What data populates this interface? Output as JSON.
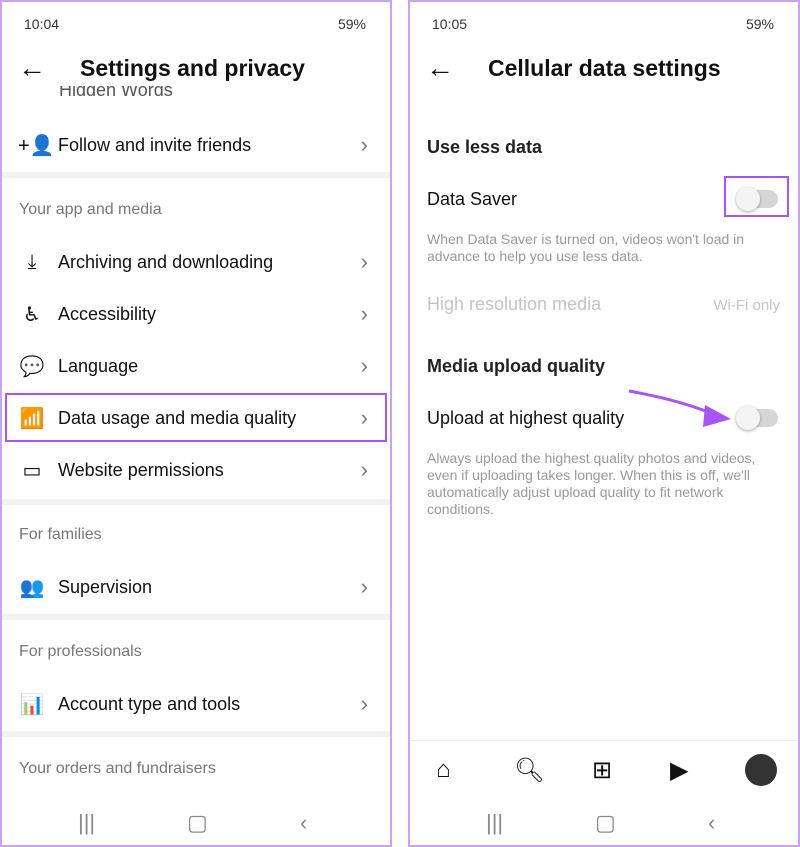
{
  "left": {
    "status": {
      "time": "10:04",
      "battery": "59%"
    },
    "title": "Settings and privacy",
    "partial_item": "Hidden Words",
    "items_top": [
      {
        "label": "Follow and invite friends",
        "icon": "add-person-icon"
      }
    ],
    "section1": "Your app and media",
    "items1": [
      {
        "label": "Archiving and downloading",
        "icon": "download-icon"
      },
      {
        "label": "Accessibility",
        "icon": "accessibility-icon"
      },
      {
        "label": "Language",
        "icon": "language-icon"
      },
      {
        "label": "Data usage and media quality",
        "icon": "signal-bars-icon",
        "highlighted": true
      },
      {
        "label": "Website permissions",
        "icon": "devices-icon"
      }
    ],
    "section2": "For families",
    "items2": [
      {
        "label": "Supervision",
        "icon": "people-icon"
      }
    ],
    "section3": "For professionals",
    "items3": [
      {
        "label": "Account type and tools",
        "icon": "chart-icon"
      }
    ],
    "section4": "Your orders and fundraisers"
  },
  "right": {
    "status": {
      "time": "10:05",
      "battery": "59%"
    },
    "title": "Cellular data settings",
    "section1": "Use less data",
    "data_saver": {
      "label": "Data Saver",
      "on": false,
      "desc": "When Data Saver is turned on, videos won't load in advance to help you use less data."
    },
    "high_res": {
      "label": "High resolution media",
      "value": "Wi-Fi only"
    },
    "section2": "Media upload quality",
    "upload": {
      "label": "Upload at highest quality",
      "on": false,
      "desc": "Always upload the highest quality photos and videos, even if uploading takes longer. When this is off, we'll automatically adjust upload quality to fit network conditions."
    }
  },
  "colors": {
    "highlight": "#a855f7",
    "border": "#c9a3ef"
  }
}
